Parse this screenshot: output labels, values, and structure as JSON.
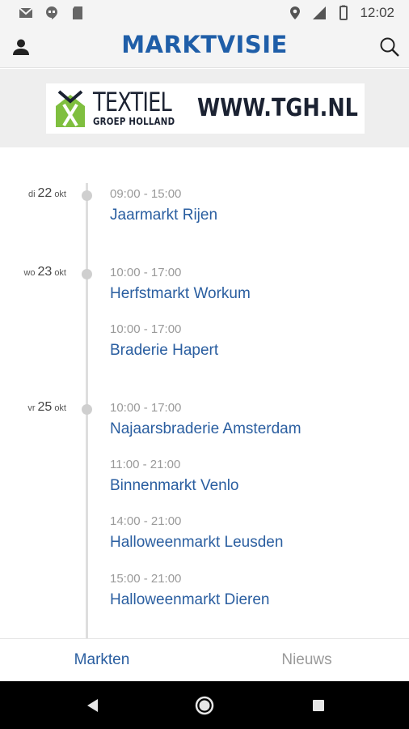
{
  "status_bar": {
    "time": "12:02",
    "icons_left": [
      "gmail-icon",
      "hangouts-icon",
      "sd-card-icon"
    ],
    "icons_right": [
      "location-icon",
      "signal-lte-icon",
      "battery-icon"
    ]
  },
  "app_bar": {
    "title": "MARKTVISIE",
    "left_icon": "user-icon",
    "right_icon": "search-icon"
  },
  "banner": {
    "brand_main": "TEXTIEL",
    "brand_sub": "GROEP HOLLAND",
    "url": "WWW.TGH.NL"
  },
  "timeline": {
    "days": [
      {
        "weekday": "di",
        "day": "22",
        "month": "okt",
        "events": [
          {
            "time": "09:00 - 15:00",
            "name": "Jaarmarkt Rijen"
          }
        ]
      },
      {
        "weekday": "wo",
        "day": "23",
        "month": "okt",
        "events": [
          {
            "time": "10:00 - 17:00",
            "name": "Herfstmarkt Workum"
          },
          {
            "time": "10:00 - 17:00",
            "name": "Braderie Hapert"
          }
        ]
      },
      {
        "weekday": "vr",
        "day": "25",
        "month": "okt",
        "events": [
          {
            "time": "10:00 - 17:00",
            "name": "Najaarsbraderie Amsterdam"
          },
          {
            "time": "11:00 - 21:00",
            "name": "Binnenmarkt Venlo"
          },
          {
            "time": "14:00 - 21:00",
            "name": "Halloweenmarkt Leusden"
          },
          {
            "time": "15:00 - 21:00",
            "name": "Halloweenmarkt Dieren"
          }
        ]
      }
    ]
  },
  "tabs": [
    {
      "label": "Markten",
      "active": true
    },
    {
      "label": "Nieuws",
      "active": false
    }
  ],
  "colors": {
    "accent": "#2a5ea0",
    "title": "#1f5ea8",
    "muted": "#9a9a9a"
  }
}
